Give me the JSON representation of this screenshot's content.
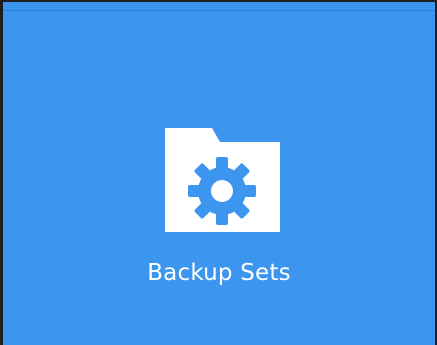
{
  "tile": {
    "label": "Backup Sets",
    "icon": "folder-gear-icon",
    "background_color": "#3c95ee",
    "foreground_color": "#ffffff"
  }
}
